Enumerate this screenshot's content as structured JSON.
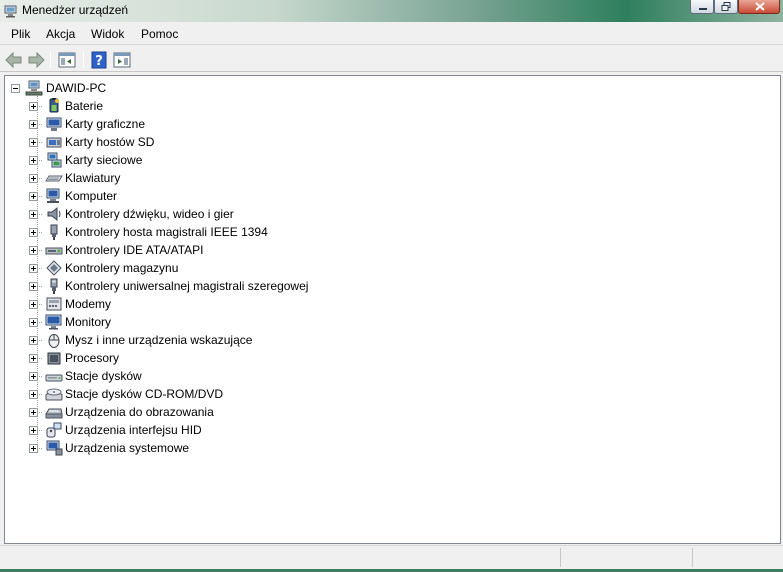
{
  "window": {
    "title": "Menedżer urządzeń"
  },
  "menu": {
    "items": [
      "Plik",
      "Akcja",
      "Widok",
      "Pomoc"
    ]
  },
  "toolbar": {
    "buttons": [
      "back-arrow-icon",
      "forward-arrow-icon",
      "show-hide-tree-icon",
      "help-icon",
      "properties-icon"
    ]
  },
  "tree": {
    "root": "DAWID-PC",
    "categories": [
      {
        "label": "Baterie",
        "icon": "battery-icon"
      },
      {
        "label": "Karty graficzne",
        "icon": "display-adapter-icon"
      },
      {
        "label": "Karty hostów SD",
        "icon": "sd-host-icon"
      },
      {
        "label": "Karty sieciowe",
        "icon": "network-adapter-icon"
      },
      {
        "label": "Klawiatury",
        "icon": "keyboard-icon"
      },
      {
        "label": "Komputer",
        "icon": "computer-icon"
      },
      {
        "label": "Kontrolery dźwięku, wideo i gier",
        "icon": "sound-icon"
      },
      {
        "label": "Kontrolery hosta magistrali IEEE 1394",
        "icon": "ieee1394-icon"
      },
      {
        "label": "Kontrolery IDE ATA/ATAPI",
        "icon": "ide-controller-icon"
      },
      {
        "label": "Kontrolery magazynu",
        "icon": "storage-controller-icon"
      },
      {
        "label": "Kontrolery uniwersalnej magistrali szeregowej",
        "icon": "usb-icon"
      },
      {
        "label": "Modemy",
        "icon": "modem-icon"
      },
      {
        "label": "Monitory",
        "icon": "monitor-icon"
      },
      {
        "label": "Mysz i inne urządzenia wskazujące",
        "icon": "mouse-icon"
      },
      {
        "label": "Procesory",
        "icon": "processor-icon"
      },
      {
        "label": "Stacje dysków",
        "icon": "disk-drive-icon"
      },
      {
        "label": "Stacje dysków CD-ROM/DVD",
        "icon": "dvd-drive-icon"
      },
      {
        "label": "Urządzenia do obrazowania",
        "icon": "imaging-device-icon"
      },
      {
        "label": "Urządzenia interfejsu HID",
        "icon": "hid-icon"
      },
      {
        "label": "Urządzenia systemowe",
        "icon": "system-device-icon"
      }
    ]
  },
  "statusbar": {
    "panes": [
      "",
      "",
      ""
    ]
  }
}
